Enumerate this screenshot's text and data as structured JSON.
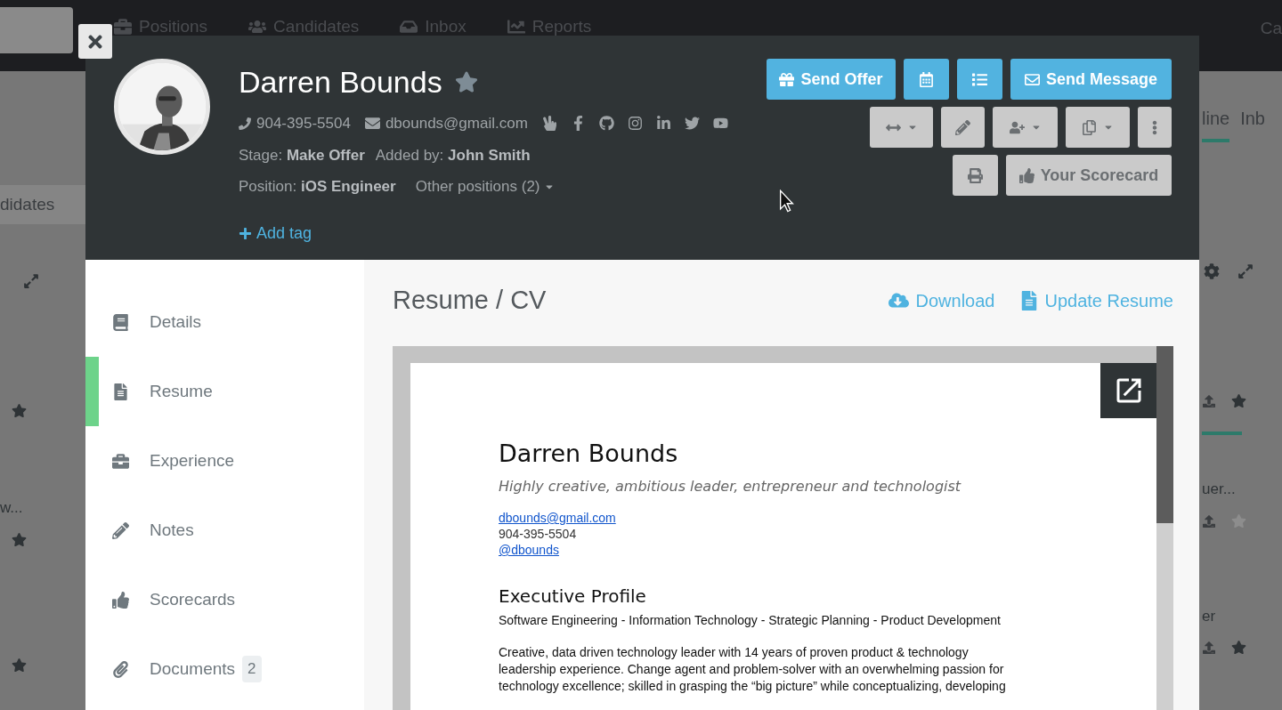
{
  "background": {
    "nav_items": [
      "Positions",
      "Candidates",
      "Inbox",
      "Reports"
    ],
    "nav_right": "Ca",
    "left_tab": "didates",
    "left_snippet": "w...",
    "left_stars": [
      {
        "starred": true
      },
      {
        "starred": true
      },
      {
        "starred": true
      }
    ],
    "right_tabs": [
      {
        "label": "line",
        "selected": true
      },
      {
        "label": "Inb",
        "selected": false
      }
    ],
    "right_snippets": [
      "uer...",
      "er"
    ],
    "right_stars": [
      {
        "starred": true
      },
      {
        "starred": false
      },
      {
        "starred": true
      }
    ]
  },
  "profile": {
    "name": "Darren Bounds",
    "starred": false,
    "phone": "904-395-5504",
    "email": "dbounds@gmail.com",
    "stage_label": "Stage:",
    "stage": "Make Offer",
    "added_label": "Added by:",
    "added_by": "John Smith",
    "position_label": "Position:",
    "position": "iOS Engineer",
    "other_positions": "Other positions (2)",
    "add_tag": "Add tag"
  },
  "actions": [
    [
      {
        "kind": "primary",
        "label": "Send Offer"
      },
      {
        "kind": "primary"
      },
      {
        "kind": "primary"
      },
      {
        "kind": "primary",
        "label": "Send Message"
      }
    ],
    [
      {
        "kind": "default",
        "dropdown": true
      },
      {
        "kind": "default",
        "dropdown": false
      },
      {
        "kind": "default",
        "dropdown": true
      },
      {
        "kind": "default",
        "dropdown": true
      },
      {
        "kind": "default",
        "dropdown": false
      }
    ],
    [
      {
        "kind": "default"
      },
      {
        "kind": "default",
        "label": "Your Scorecard"
      }
    ]
  ],
  "sidebar": {
    "items": [
      {
        "label": "Details",
        "selected": false
      },
      {
        "label": "Resume",
        "selected": true
      },
      {
        "label": "Experience",
        "selected": false
      },
      {
        "label": "Notes",
        "selected": false
      },
      {
        "label": "Scorecards",
        "selected": false
      },
      {
        "label": "Documents",
        "selected": false,
        "badge": "2"
      }
    ]
  },
  "content": {
    "title": "Resume / CV",
    "links": [
      "Download",
      "Update Resume"
    ],
    "resume": {
      "name": "Darren Bounds",
      "tagline": "Highly creative, ambitious leader, entrepreneur and technologist",
      "email": "dbounds@gmail.com",
      "phone": "904-395-5504",
      "handle": "@dbounds",
      "section_title": "Executive Profile",
      "keywords": "Software Engineering - Information Technology - Strategic Planning - Product Development",
      "summary_lines": [
        "Creative, data driven technology leader with 14 years of proven product & technology",
        "leadership experience. Change agent and problem-solver with an overwhelming passion for",
        "technology excellence; skilled in grasping the “big picture” while conceptualizing, developing"
      ]
    }
  }
}
